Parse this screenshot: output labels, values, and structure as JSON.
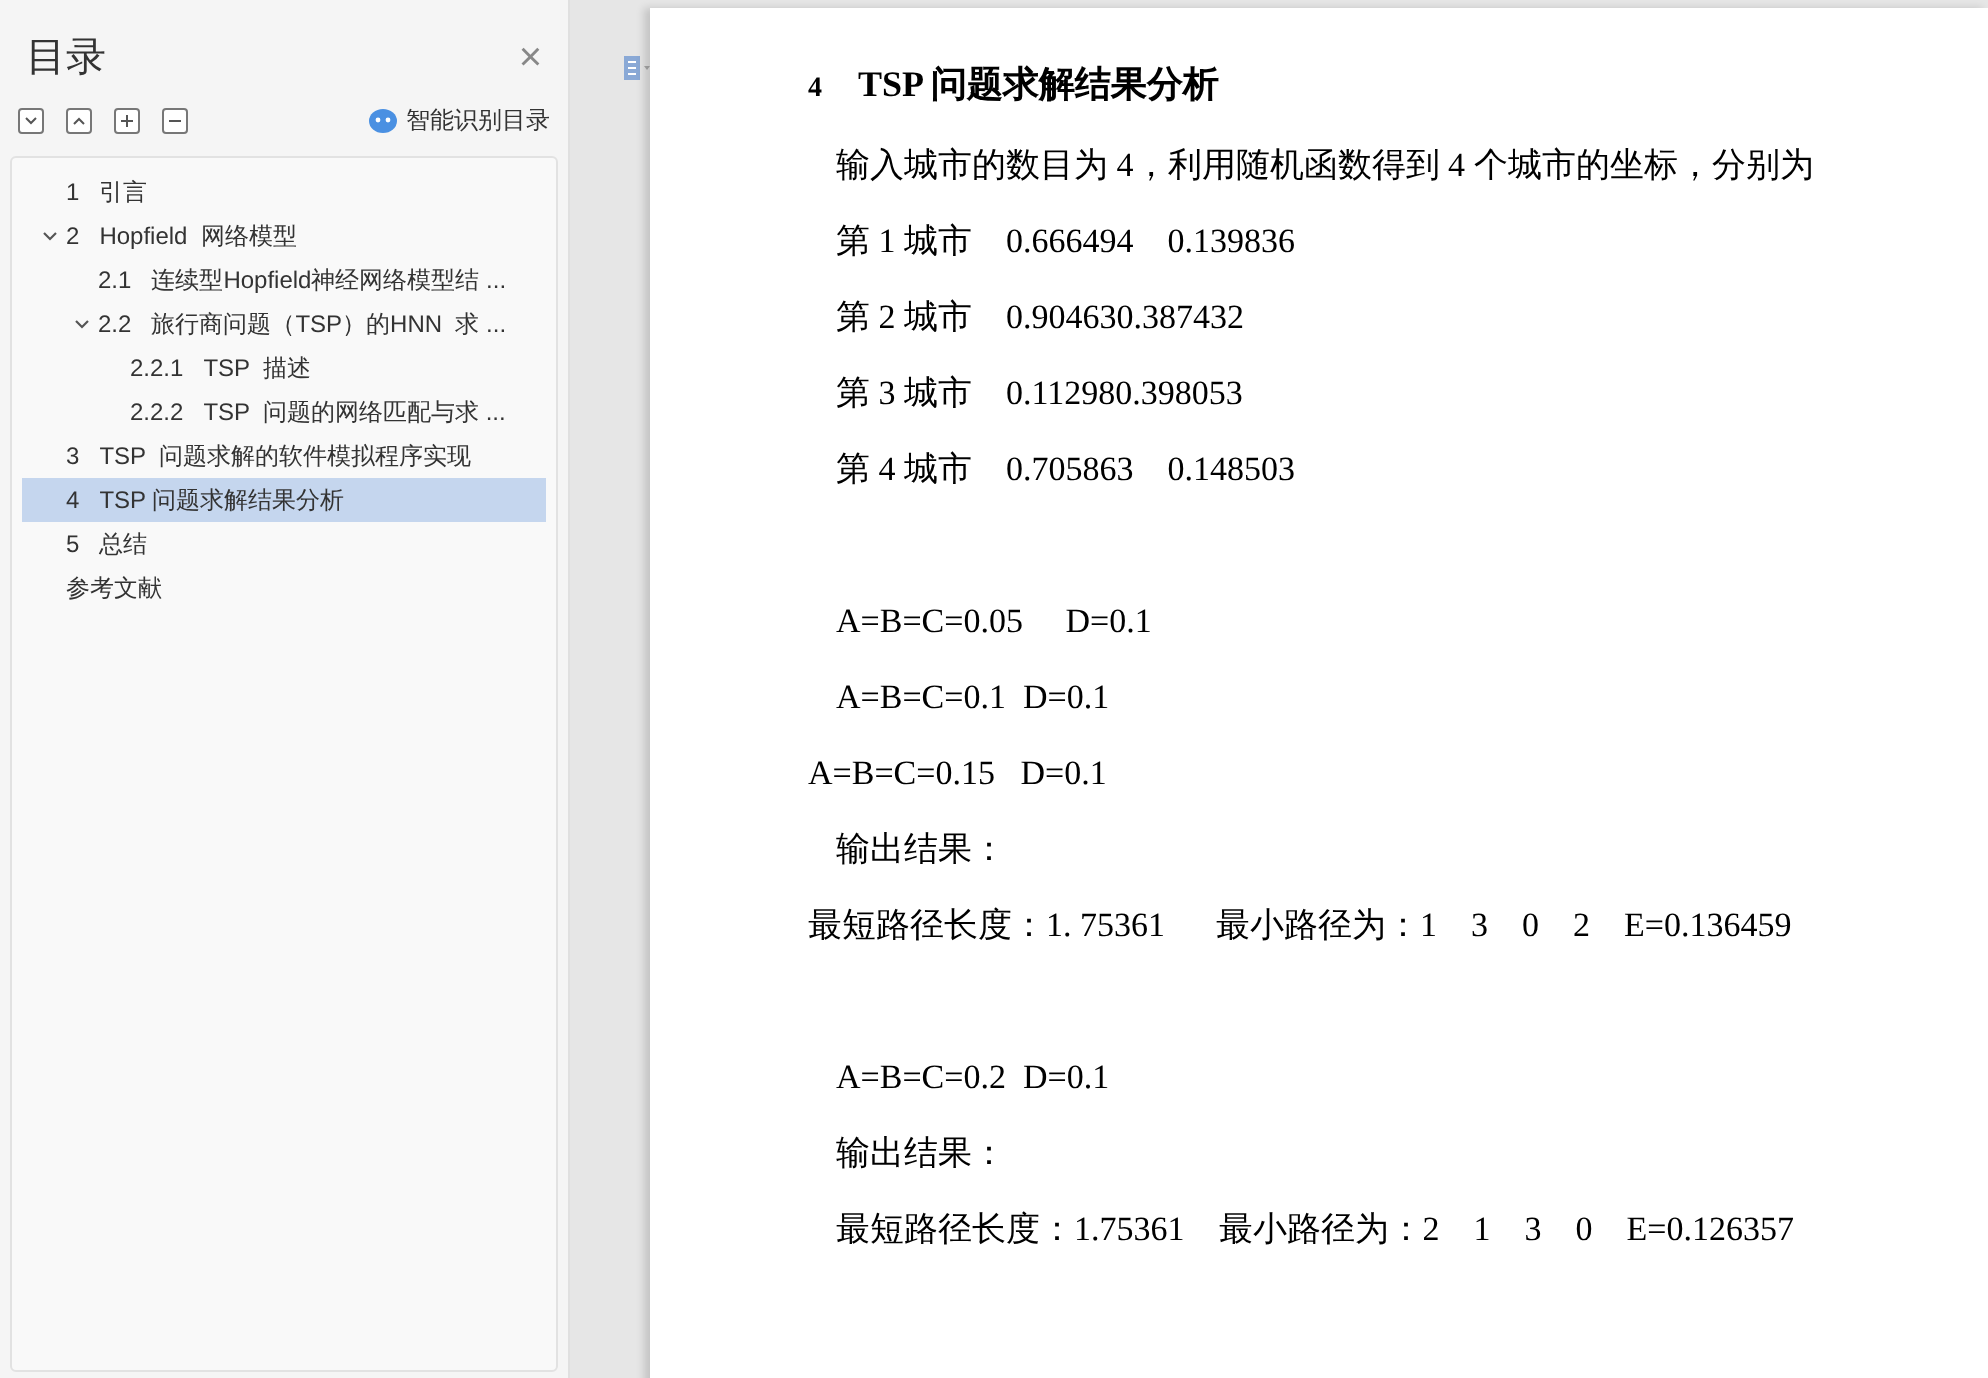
{
  "sidebar": {
    "title": "目录",
    "close": "×",
    "smart_toc": "智能识别目录",
    "toc": [
      {
        "number": "1",
        "label": "引言",
        "selected": false
      },
      {
        "number": "2",
        "label": "Hopfield  网络模型",
        "selected": false,
        "expanded": true,
        "children": [
          {
            "number": "2.1",
            "label": "连续型Hopfield神经网络模型结 ...",
            "selected": false
          },
          {
            "number": "2.2",
            "label": "旅行商问题（TSP）的HNN  求 ...",
            "selected": false,
            "expanded": true,
            "children": [
              {
                "number": "2.2.1",
                "label": "TSP  描述",
                "selected": false
              },
              {
                "number": "2.2.2",
                "label": "TSP  问题的网络匹配与求 ...",
                "selected": false
              }
            ]
          }
        ]
      },
      {
        "number": "3",
        "label": "TSP  问题求解的软件模拟程序实现",
        "selected": false
      },
      {
        "number": "4",
        "label": "TSP 问题求解结果分析",
        "selected": true
      },
      {
        "number": "5",
        "label": "总结",
        "selected": false
      },
      {
        "label": "参考文献",
        "selected": false
      }
    ]
  },
  "document": {
    "heading": {
      "number": "4",
      "title": "TSP 问题求解结果分析"
    },
    "blocks": [
      [
        {
          "kind": "indented",
          "text": "输入城市的数目为 4，利用随机函数得到 4 个城市的坐标，分别为"
        },
        {
          "kind": "indented",
          "text": "第 1 城市    0.666494    0.139836"
        },
        {
          "kind": "indented",
          "text": "第 2 城市    0.904630.387432"
        },
        {
          "kind": "indented",
          "text": "第 3 城市    0.112980.398053"
        },
        {
          "kind": "indented",
          "text": "第 4 城市    0.705863    0.148503"
        }
      ],
      [
        {
          "kind": "indented",
          "text": "A=B=C=0.05     D=0.1"
        },
        {
          "kind": "indented",
          "text": "A=B=C=0.1  D=0.1"
        },
        {
          "kind": "flush",
          "text": "A=B=C=0.15   D=0.1"
        },
        {
          "kind": "indented",
          "text": "输出结果："
        },
        {
          "kind": "flush",
          "text": "最短路径长度：1. 75361      最小路径为：1    3    0    2    E=0.136459"
        }
      ],
      [
        {
          "kind": "indented",
          "text": "A=B=C=0.2  D=0.1"
        },
        {
          "kind": "indented",
          "text": "输出结果："
        },
        {
          "kind": "indented",
          "text": "最短路径长度：1.75361    最小路径为：2    1    3    0    E=0.126357"
        }
      ]
    ]
  }
}
